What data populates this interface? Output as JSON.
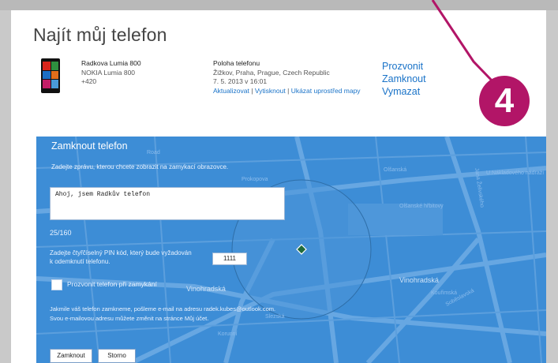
{
  "page": {
    "title": "Najít můj telefon"
  },
  "device": {
    "name": "Radkova Lumia 800",
    "model": "NOKIA Lumia 800",
    "number": "+420"
  },
  "location": {
    "heading": "Poloha telefonu",
    "address": "Žižkov, Praha, Prague, Czech Republic",
    "timestamp": "7. 5. 2013 v 16:01",
    "link_update": "Aktualizovat",
    "link_print": "Vytisknout",
    "link_center": "Ukázat uprostřed mapy",
    "separator": "|"
  },
  "actions": {
    "ring": "Prozvonit",
    "lock": "Zamknout",
    "erase": "Vymazat"
  },
  "lock_panel": {
    "title": "Zamknout telefon",
    "prompt": "Zadejte zprávu, kterou chcete zobrazit na zamykací obrazovce.",
    "message_value": "Ahoj, jsem Radkův telefon",
    "counter": "25/160",
    "pin_label": "Zadejte čtyřčíselný PIN kód, který bude vyžadován k odemknutí telefonu.",
    "pin_value": "1111",
    "ring_checkbox_label": "Prozvonit telefon při zamykání",
    "ring_checkbox_checked": false,
    "info": "Jakmile váš telefon zamkneme, pošleme e-mail na adresu radek.kubes@outlook.com. Svou e-mailovou adresu můžete změnit na stránce Můj účet.",
    "lock_button": "Zamknout",
    "cancel_button": "Storno"
  },
  "map_labels": {
    "road": "Road",
    "olsanska": "Olšanská",
    "jana_zelivskeho": "Jana Želivského",
    "nakladovemu": "U Nákladového nádraží",
    "pristavni": "Prokopova",
    "vinohradska": "Vinohradská",
    "vinohradska2": "Vinohradská",
    "slezska": "Slezská",
    "koruni": "Korunní",
    "sobeslavska": "Soběslavská",
    "kouřimska": "Kouřimská",
    "olsanske_hrbitovy": "Olšanské hřbitovy"
  },
  "annotation": {
    "badge_number": "4"
  },
  "colors": {
    "panel_blue": "#3d8dd6",
    "link_blue": "#1a73c8",
    "annotation_magenta": "#b21567"
  }
}
